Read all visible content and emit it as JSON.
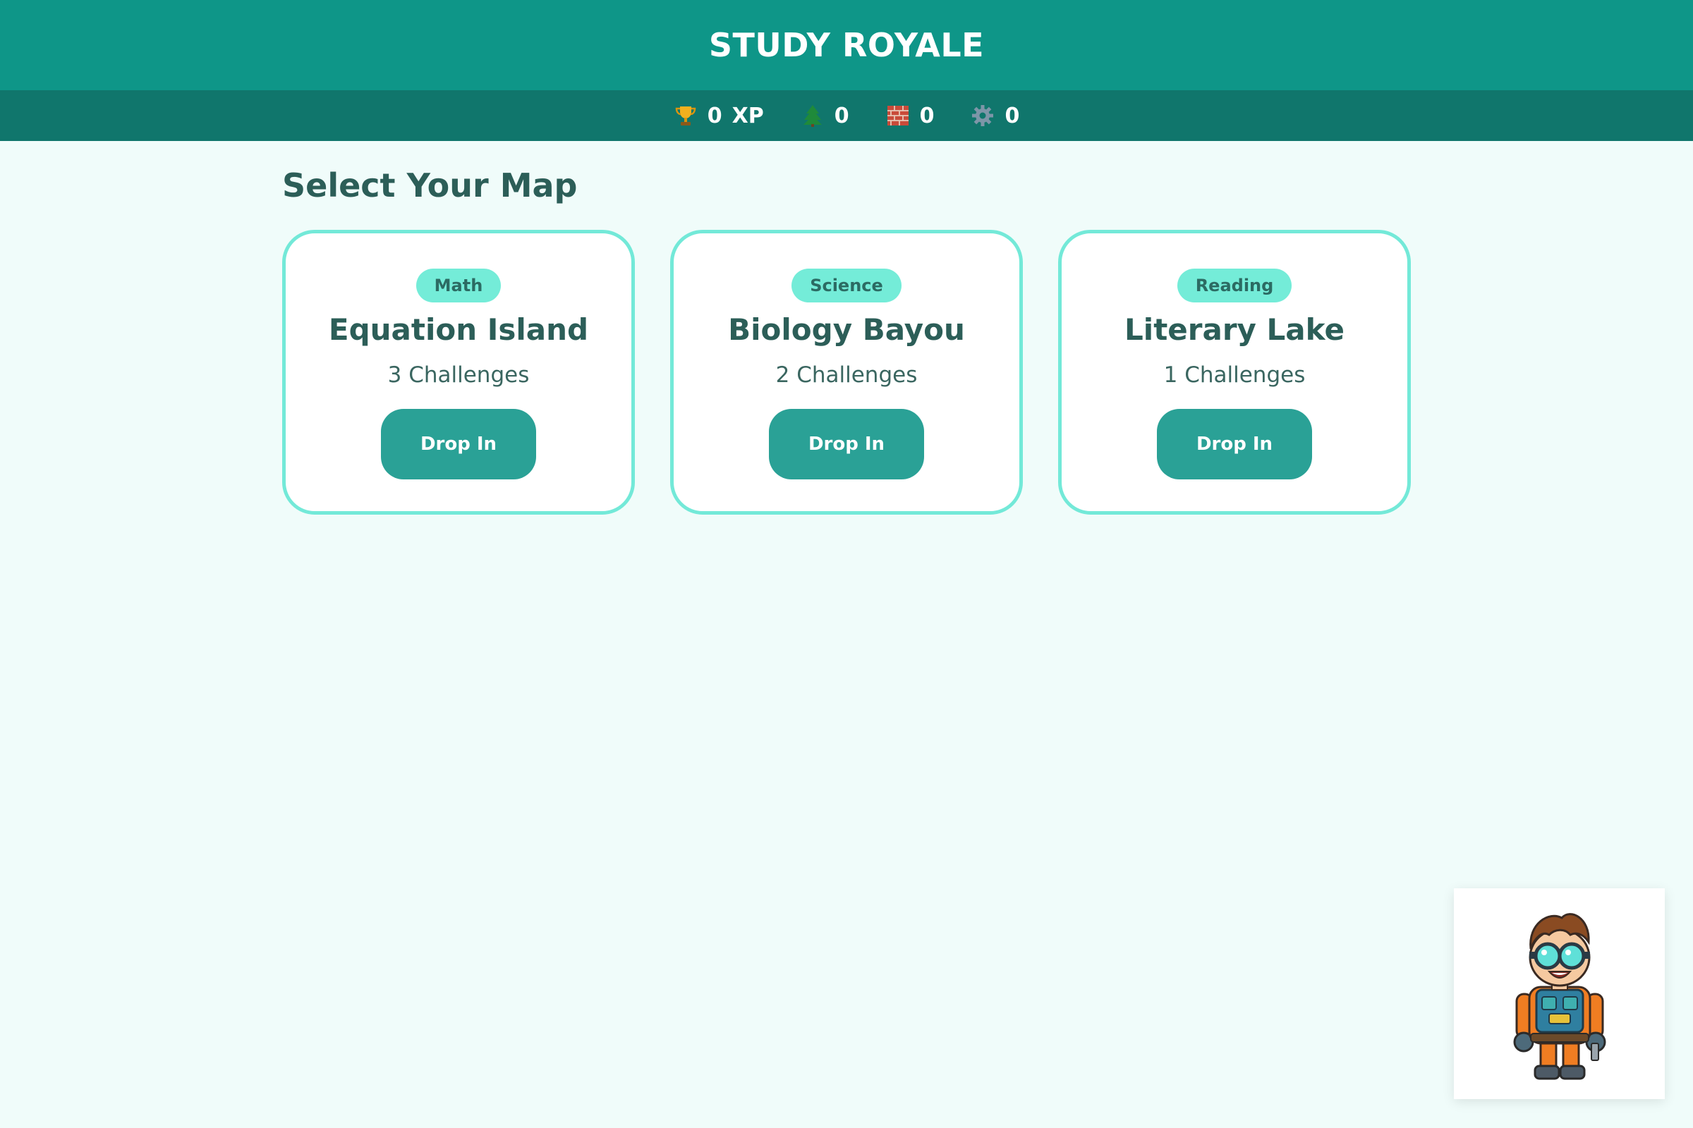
{
  "header": {
    "title": "STUDY ROYALE"
  },
  "stats": [
    {
      "icon": "trophy-icon",
      "value": "0",
      "unit": "XP"
    },
    {
      "icon": "tree-icon",
      "value": "0",
      "unit": ""
    },
    {
      "icon": "brick-icon",
      "value": "0",
      "unit": ""
    },
    {
      "icon": "gear-icon",
      "value": "0",
      "unit": ""
    }
  ],
  "main": {
    "title": "Select Your Map",
    "maps": [
      {
        "subject": "Math",
        "name": "Equation Island",
        "challenges": "3 Challenges",
        "button": "Drop In"
      },
      {
        "subject": "Science",
        "name": "Biology Bayou",
        "challenges": "2 Challenges",
        "button": "Drop In"
      },
      {
        "subject": "Reading",
        "name": "Literary Lake",
        "challenges": "1 Challenges",
        "button": "Drop In"
      }
    ]
  },
  "avatar": {
    "icon": "character-avatar"
  },
  "colors": {
    "header": "#0e9688",
    "stats_bar": "#10766c",
    "background": "#f0fcfa",
    "card_border": "#73e9d8",
    "tag": "#74ecd8",
    "button": "#2aa196",
    "text": "#2c5e58"
  }
}
